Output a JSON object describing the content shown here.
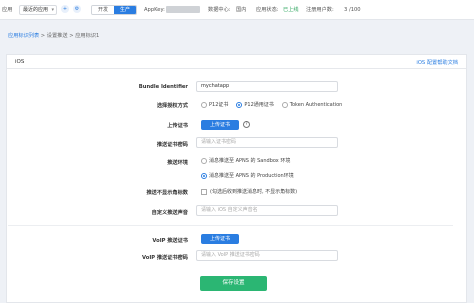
{
  "topbar": {
    "app_label": "应用",
    "app_select_value": "最近的应用",
    "env_dev": "开发",
    "env_prod": "生产",
    "appkey_label": "AppKey:",
    "datacenter_label": "数据中心:",
    "datacenter_value": "国内",
    "app_status_label": "应用状态:",
    "app_status_value": "已上线",
    "registered_users_label": "注册用户数:",
    "registered_users_value": "3 /100",
    "plus_icon": "plus-icon",
    "settings_icon": "gear-icon"
  },
  "breadcrumb": {
    "item1": "应用标识列表",
    "sep1": " > ",
    "item2": "设置推送",
    "sep2": " > ",
    "item3": "应用标识1"
  },
  "card": {
    "title": "iOS",
    "doc_link": "iOS 配置帮助文档"
  },
  "form": {
    "bundle_label": "Bundle Identifier",
    "bundle_value": "mychatapp",
    "auth_label": "选择授权方式",
    "auth_options": [
      "P12证书",
      "P12通用证书",
      "Token Authentication"
    ],
    "auth_selected": "P12通用证书",
    "upload_cert_label": "上传证书",
    "upload_cert_button": "上传证书",
    "help_icon_glyph": "?",
    "cert_password_label": "推送证书密码",
    "cert_password_placeholder": "请输入证书密码",
    "env_label": "推送环境",
    "env_options": [
      "消息推送至 APNS 的 Sandbox 环境",
      "消息推送至 APNS 的 Production环境"
    ],
    "env_selected": "消息推送至 APNS 的 Production环境",
    "badge_label": "推送不显示角标数",
    "badge_checkbox": "(勾选后收到推送消息时, 不显示角标数)",
    "badge_checked": false,
    "sound_label": "自定义推送声音",
    "sound_placeholder": "请输入 iOS 自定义声音名",
    "voip_cert_label": "VoIP 推送证书",
    "voip_upload_button": "上传证书",
    "voip_password_label": "VoIP 推送证书密码",
    "voip_password_placeholder": "请输入 VoIP 推送证书密码",
    "save_button": "保存设置"
  },
  "colors": {
    "accent": "#2a7de1",
    "save": "#2bb673",
    "status_ok": "#2aa35b"
  }
}
